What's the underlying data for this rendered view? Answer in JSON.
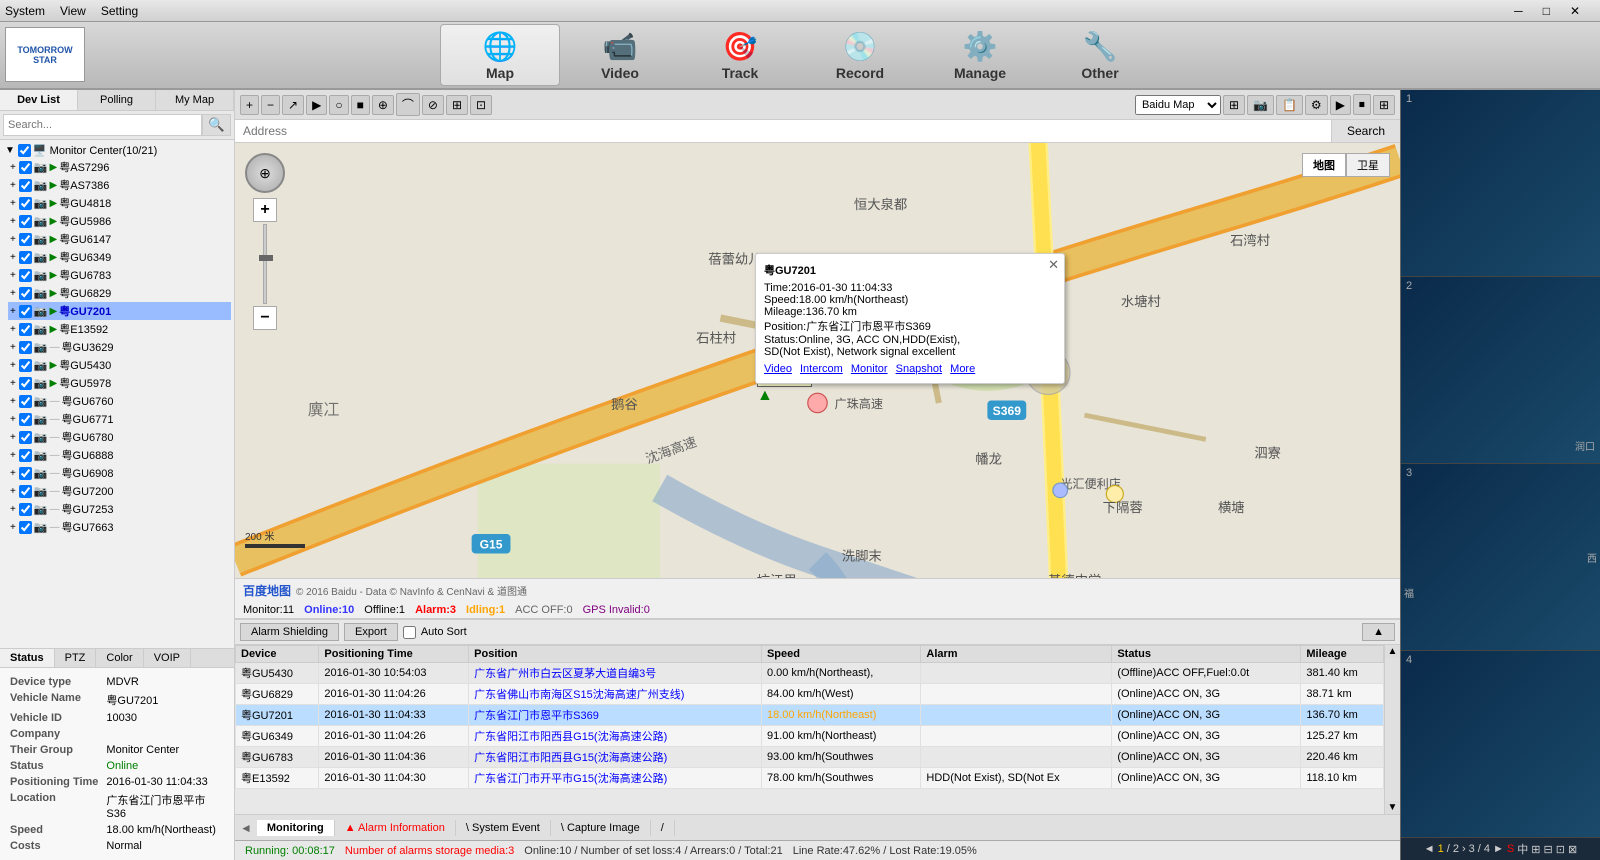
{
  "menubar": {
    "items": [
      "System",
      "View",
      "Setting"
    ]
  },
  "nav": {
    "tabs": [
      {
        "id": "map",
        "label": "Map",
        "icon": "🌐",
        "active": true
      },
      {
        "id": "video",
        "label": "Video",
        "icon": "📹"
      },
      {
        "id": "track",
        "label": "Track",
        "icon": "🎯"
      },
      {
        "id": "record",
        "label": "Record",
        "icon": "💿"
      },
      {
        "id": "manage",
        "label": "Manage",
        "icon": "⚙️"
      },
      {
        "id": "other",
        "label": "Other",
        "icon": "🔧"
      }
    ]
  },
  "left_panel": {
    "tabs": [
      "Dev List",
      "Polling",
      "My Map"
    ],
    "active_tab": "Dev List",
    "tree_root": "Monitor Center(10/21)",
    "devices": [
      {
        "name": "AS7296",
        "selected": false,
        "active": true
      },
      {
        "name": "AS7386",
        "selected": false,
        "active": true
      },
      {
        "name": "GU4818",
        "selected": false,
        "active": true
      },
      {
        "name": "GU5986",
        "selected": false,
        "active": true
      },
      {
        "name": "GU6147",
        "selected": false,
        "active": true
      },
      {
        "name": "GU6349",
        "selected": false,
        "active": true
      },
      {
        "name": "GU6783",
        "selected": false,
        "active": true
      },
      {
        "name": "GU6829",
        "selected": false,
        "active": true
      },
      {
        "name": "GU7201",
        "selected": true,
        "active": true,
        "highlighted": true
      },
      {
        "name": "E13592",
        "selected": false,
        "active": true
      },
      {
        "name": "GU3629",
        "selected": false,
        "active": false
      },
      {
        "name": "GU5430",
        "selected": false,
        "active": true
      },
      {
        "name": "GU5978",
        "selected": false,
        "active": true
      },
      {
        "name": "GU6760",
        "selected": false,
        "active": false
      },
      {
        "name": "GU6771",
        "selected": false,
        "active": false
      },
      {
        "name": "GU6780",
        "selected": false,
        "active": false
      },
      {
        "name": "GU6888",
        "selected": false,
        "active": false
      },
      {
        "name": "GU6908",
        "selected": false,
        "active": false
      },
      {
        "name": "GU7200",
        "selected": false,
        "active": false
      },
      {
        "name": "GU7253",
        "selected": false,
        "active": false
      },
      {
        "name": "GU7663",
        "selected": false,
        "active": false
      }
    ]
  },
  "status_tabs": [
    "Status",
    "PTZ",
    "Color",
    "VOIP"
  ],
  "device_status": {
    "device_type": {
      "label": "Device type",
      "value": "MDVR"
    },
    "vehicle_name": {
      "label": "Vehicle Name",
      "value": "粤GU7201"
    },
    "vehicle_id": {
      "label": "Vehicle ID",
      "value": "10030"
    },
    "company": {
      "label": "Company",
      "value": ""
    },
    "their_group": {
      "label": "Their Group",
      "value": "Monitor Center"
    },
    "status": {
      "label": "Status",
      "value": "Online"
    },
    "positioning_time": {
      "label": "Positioning Time",
      "value": "2016-01-30 11:04:33"
    },
    "location": {
      "label": "Location",
      "value": "广东省江门市恩平市S36"
    },
    "speed": {
      "label": "Speed",
      "value": "18.00 km/h(Northeast)"
    },
    "costs": {
      "label": "Costs",
      "value": "Normal"
    }
  },
  "map": {
    "address_placeholder": "Address",
    "search_label": "Search",
    "type_map": "地图",
    "type_satellite": "卫星",
    "scale": "200 米",
    "footer": "© 2016 Baidu - Data © NavInfo & CenNavi & 道图通"
  },
  "popup": {
    "title": "粤GU7201",
    "time": "Time:2016-01-30 11:04:33",
    "speed": "Speed:18.00 km/h(Northeast)",
    "mileage": "Mileage:136.70 km",
    "position": "Position:广东省江门市恩平市S369",
    "status": "Status:Online, 3G, ACC ON,HDD(Exist),",
    "sd": "SD(Not Exist), Network signal excellent",
    "links": [
      "Video",
      "Intercom",
      "Monitor",
      "Snapshot",
      "More"
    ]
  },
  "stats_bar": {
    "monitor": "Monitor:11",
    "online": "Online:10",
    "offline": "Offline:1",
    "alarm": "Alarm:3",
    "idling": "Idling:1",
    "acc_off": "ACC OFF:0",
    "gps_invalid": "GPS Invalid:0"
  },
  "data_toolbar": {
    "alarm_shielding": "Alarm Shielding",
    "export": "Export",
    "auto_sort": "Auto Sort"
  },
  "data_table": {
    "columns": [
      "Device",
      "Positioning Time",
      "Position",
      "Speed",
      "Alarm",
      "Status",
      "Mileage"
    ],
    "rows": [
      {
        "device": "粤GU5430",
        "time": "2016-01-30 10:54:03",
        "position": "广东省广州市白云区夏茅大道自编3号",
        "speed": "0.00 km/h(Northeast),",
        "alarm": "",
        "status": "(Offline)ACC OFF,Fuel:0.0t",
        "mileage": "381.40 km",
        "selected": false
      },
      {
        "device": "粤GU6829",
        "time": "2016-01-30 11:04:26",
        "position": "广东省佛山市南海区S15沈海高速广州支线)",
        "speed": "84.00 km/h(West)",
        "alarm": "",
        "status": "(Online)ACC ON, 3G",
        "mileage": "38.71 km",
        "selected": false
      },
      {
        "device": "粤GU7201",
        "time": "2016-01-30 11:04:33",
        "position": "广东省江门市恩平市S369",
        "speed": "18.00 km/h(Northeast)",
        "alarm": "",
        "status": "(Online)ACC ON, 3G",
        "mileage": "136.70 km",
        "selected": true
      },
      {
        "device": "粤GU6349",
        "time": "2016-01-30 11:04:26",
        "position": "广东省阳江市阳西县G15(沈海高速公路)",
        "speed": "91.00 km/h(Northeast)",
        "alarm": "",
        "status": "(Online)ACC ON, 3G",
        "mileage": "125.27 km",
        "selected": false
      },
      {
        "device": "粤GU6783",
        "time": "2016-01-30 11:04:36",
        "position": "广东省阳江市阳西县G15(沈海高速公路)",
        "speed": "93.00 km/h(Southwes",
        "alarm": "",
        "status": "(Online)ACC ON, 3G",
        "mileage": "220.46 km",
        "selected": false
      },
      {
        "device": "粤E13592",
        "time": "2016-01-30 11:04:30",
        "position": "广东省江门市开平市G15(沈海高速公路)",
        "speed": "78.00 km/h(Southwes",
        "alarm": "HDD(Not Exist), SD(Not Ex",
        "status": "(Online)ACC ON, 3G",
        "mileage": "118.10 km",
        "selected": false
      }
    ]
  },
  "bottom_nav": {
    "tabs": [
      "Monitoring",
      "Alarm Information",
      "System Event",
      "Capture Image",
      "/"
    ]
  },
  "status_bar": {
    "running": "Running: 00:08:17",
    "alarm_storage": "Number of alarms storage media:3",
    "online_count": "Online:10 / Number of set loss:4 / Arrears:0 / Total:21",
    "line_rate": "Line Rate:47.62% / Lost Rate:19.05%"
  },
  "right_panel": {
    "slots": [
      1,
      2,
      3,
      4
    ],
    "video_nav": "◄ 1 / 2 › 3 / 4 ►"
  }
}
